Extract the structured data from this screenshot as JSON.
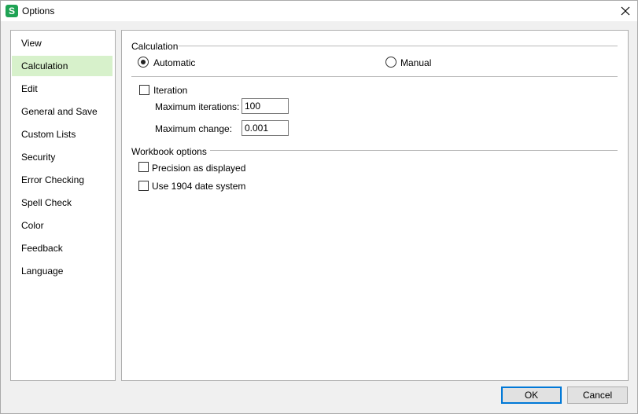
{
  "window": {
    "title": "Options",
    "app_icon_glyph": "S",
    "accent_color": "#1fa354"
  },
  "sidebar": {
    "items": [
      {
        "label": "View"
      },
      {
        "label": "Calculation",
        "selected": true
      },
      {
        "label": "Edit"
      },
      {
        "label": "General and Save"
      },
      {
        "label": "Custom Lists"
      },
      {
        "label": "Security"
      },
      {
        "label": "Error Checking"
      },
      {
        "label": "Spell Check"
      },
      {
        "label": "Color"
      },
      {
        "label": "Feedback"
      },
      {
        "label": "Language"
      }
    ],
    "selected_color": "#d7f1cb"
  },
  "calculation": {
    "group_title": "Calculation",
    "automatic_label": "Automatic",
    "manual_label": "Manual",
    "selected_mode": "Automatic",
    "iteration_label": "Iteration",
    "iteration_checked": false,
    "max_iterations_label": "Maximum iterations:",
    "max_iterations_value": "100",
    "max_change_label": "Maximum change:",
    "max_change_value": "0.001"
  },
  "workbook": {
    "group_title": "Workbook options",
    "precision_label": "Precision as displayed",
    "precision_checked": false,
    "date1904_label": "Use 1904 date system",
    "date1904_checked": false
  },
  "buttons": {
    "ok_label": "OK",
    "cancel_label": "Cancel"
  }
}
